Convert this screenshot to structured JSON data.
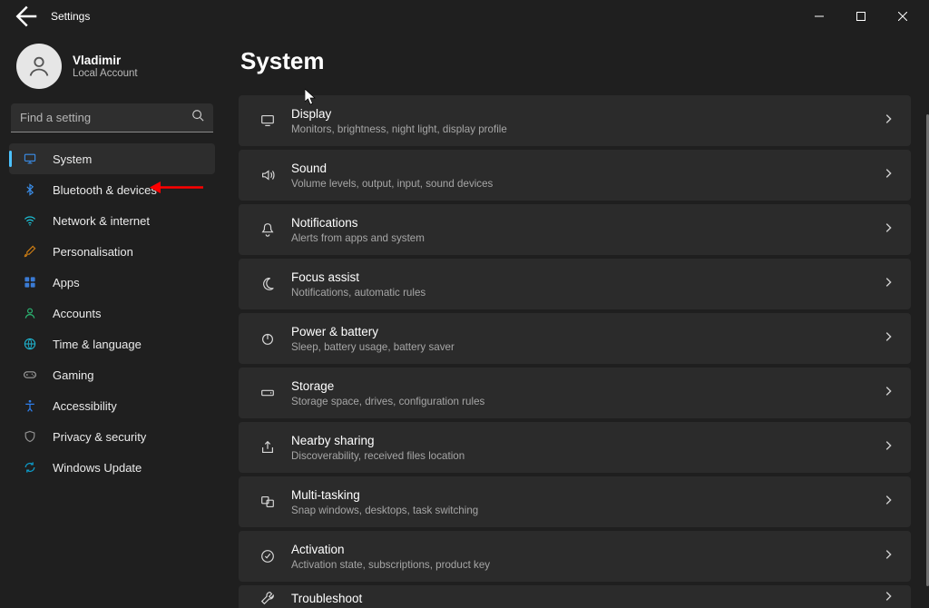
{
  "window": {
    "title": "Settings"
  },
  "account": {
    "name": "Vladimir",
    "subtitle": "Local Account"
  },
  "search": {
    "placeholder": "Find a setting",
    "value": ""
  },
  "page": {
    "title": "System"
  },
  "sidebar": {
    "items": [
      {
        "icon": "system",
        "label": "System",
        "selected": true
      },
      {
        "icon": "bt",
        "label": "Bluetooth & devices",
        "selected": false
      },
      {
        "icon": "wifi",
        "label": "Network & internet",
        "selected": false
      },
      {
        "icon": "brush",
        "label": "Personalisation",
        "selected": false
      },
      {
        "icon": "apps",
        "label": "Apps",
        "selected": false
      },
      {
        "icon": "user",
        "label": "Accounts",
        "selected": false
      },
      {
        "icon": "lang",
        "label": "Time & language",
        "selected": false
      },
      {
        "icon": "game",
        "label": "Gaming",
        "selected": false
      },
      {
        "icon": "access",
        "label": "Accessibility",
        "selected": false
      },
      {
        "icon": "shield",
        "label": "Privacy & security",
        "selected": false
      },
      {
        "icon": "update",
        "label": "Windows Update",
        "selected": false
      }
    ]
  },
  "rows": [
    {
      "icon": "display",
      "title": "Display",
      "sub": "Monitors, brightness, night light, display profile"
    },
    {
      "icon": "sound",
      "title": "Sound",
      "sub": "Volume levels, output, input, sound devices"
    },
    {
      "icon": "bell",
      "title": "Notifications",
      "sub": "Alerts from apps and system"
    },
    {
      "icon": "moon",
      "title": "Focus assist",
      "sub": "Notifications, automatic rules"
    },
    {
      "icon": "power",
      "title": "Power & battery",
      "sub": "Sleep, battery usage, battery saver"
    },
    {
      "icon": "storage",
      "title": "Storage",
      "sub": "Storage space, drives, configuration rules"
    },
    {
      "icon": "share",
      "title": "Nearby sharing",
      "sub": "Discoverability, received files location"
    },
    {
      "icon": "multi",
      "title": "Multi-tasking",
      "sub": "Snap windows, desktops, task switching"
    },
    {
      "icon": "check",
      "title": "Activation",
      "sub": "Activation state, subscriptions, product key"
    },
    {
      "icon": "wrench",
      "title": "Troubleshoot",
      "sub": ""
    }
  ],
  "annotation": {
    "arrow_target": "Bluetooth & devices"
  }
}
